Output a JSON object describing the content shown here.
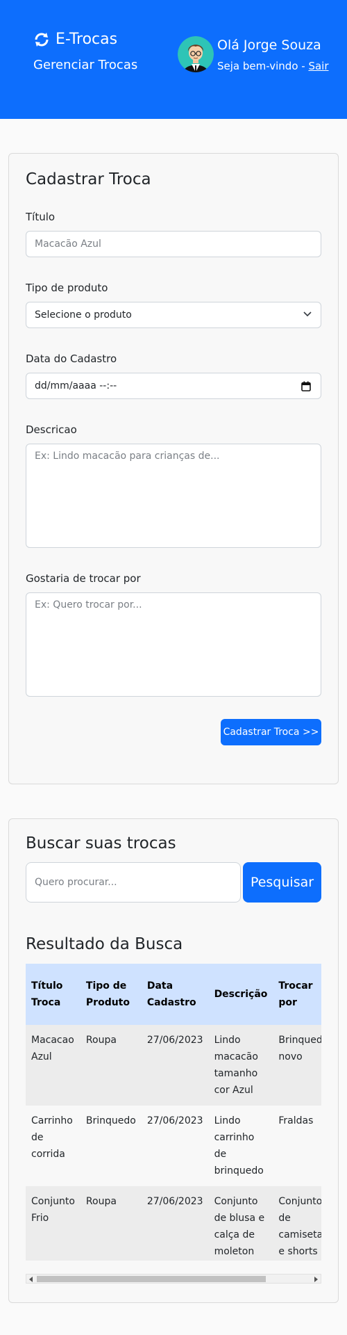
{
  "header": {
    "brand": "E-Trocas",
    "subtitle": "Gerenciar Trocas",
    "greeting": "Olá Jorge Souza",
    "welcome_prefix": "Seja bem-vindo - ",
    "logout_label": "Sair",
    "background": "#0d6efd"
  },
  "form": {
    "title": "Cadastrar Troca",
    "titulo_label": "Título",
    "titulo_placeholder": "Macacão Azul",
    "tipo_label": "Tipo de produto",
    "tipo_selected": "Selecione o produto",
    "data_label": "Data do Cadastro",
    "data_value": "dd/mm/aaaa --:--",
    "descricao_label": "Descricao",
    "descricao_placeholder": "Ex: Lindo macacão para crianças de...",
    "trocar_label": "Gostaria de trocar por",
    "trocar_placeholder": "Ex: Quero trocar por...",
    "submit_label": "Cadastrar Troca >>"
  },
  "search": {
    "title": "Buscar suas trocas",
    "placeholder": "Quero procurar...",
    "button_label": "Pesquisar",
    "results_title": "Resultado da Busca"
  },
  "table": {
    "headers": [
      "Título Troca",
      "Tipo de Produto",
      "Data Cadastro",
      "Descrição",
      "Trocar por"
    ],
    "rows": [
      [
        "Macacao Azul",
        "Roupa",
        "27/06/2023",
        "Lindo macacão tamanho cor Azul",
        "Brinquedo novo"
      ],
      [
        "Carrinho de corrida",
        "Brinquedo",
        "27/06/2023",
        "Lindo carrinho de brinquedo",
        "Fraldas"
      ],
      [
        "Conjunto Frio",
        "Roupa",
        "27/06/2023",
        "Conjunto de blusa e calça de moleton",
        "Conjunto de camiseta e shorts"
      ]
    ]
  },
  "icons": {
    "brand": "sync-icon",
    "avatar": "user-avatar",
    "select": "chevron-down-icon",
    "date": "calendar-icon"
  }
}
